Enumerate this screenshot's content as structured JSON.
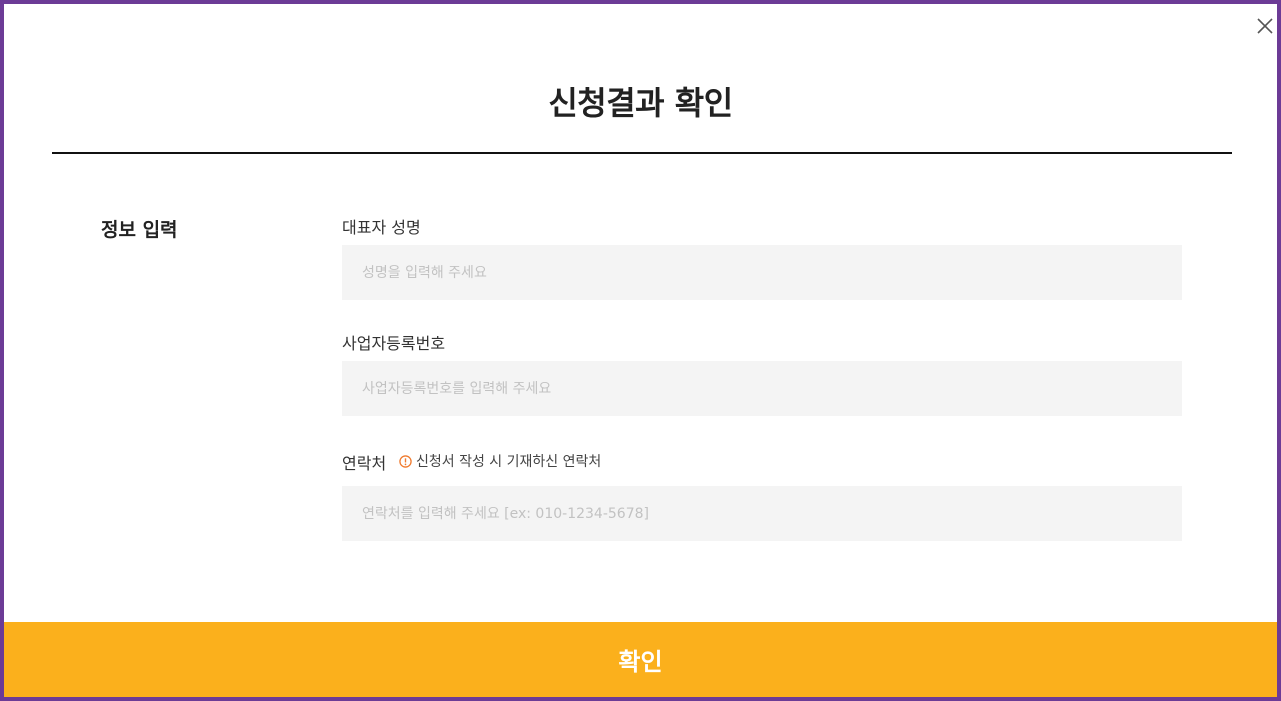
{
  "modal": {
    "title": "신청결과 확인",
    "close_icon": "close-icon",
    "border_color": "#6c3b96"
  },
  "section": {
    "label": "정보 입력"
  },
  "fields": [
    {
      "label": "대표자 성명",
      "value": "",
      "placeholder": "성명을 입력해 주세요"
    },
    {
      "label": "사업자등록번호",
      "value": "",
      "placeholder": "사업자등록번호를 입력해 주세요"
    },
    {
      "label": "연락처",
      "note": "신청서 작성 시 기재하신 연락처",
      "note_icon": "info-circle-icon",
      "note_color": "#f07b2f",
      "value": "",
      "placeholder": "연락처를 입력해 주세요 [ex: 010-1234-5678]"
    }
  ],
  "footer": {
    "confirm_label": "확인",
    "confirm_color": "#fbb01c"
  }
}
